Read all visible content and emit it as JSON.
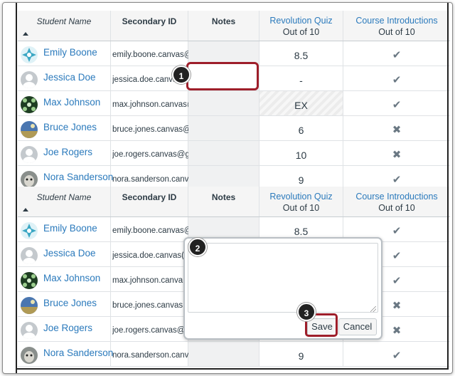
{
  "columns": {
    "student_name": "Student Name",
    "secondary_id": "Secondary ID",
    "notes": "Notes",
    "quiz": {
      "title": "Revolution Quiz",
      "sub": "Out of 10"
    },
    "intro": {
      "title": "Course Introductions",
      "sub": "Out of 10"
    }
  },
  "table1": [
    {
      "name": "Emily Boone",
      "secondary_id": "emily.boone.canvas@",
      "score": "8.5",
      "status": "✔",
      "avatar": "blue-pattern-avatar"
    },
    {
      "name": "Jessica Doe",
      "secondary_id": "jessica.doe.canvas@",
      "score": "-",
      "status": "✔",
      "avatar": "default-avatar"
    },
    {
      "name": "Max Johnson",
      "secondary_id": "max.johnson.canvas@",
      "score": "EX",
      "status": "✔",
      "avatar": "green-pattern-avatar"
    },
    {
      "name": "Bruce Jones",
      "secondary_id": "bruce.jones.canvas@",
      "score": "6",
      "status": "✖",
      "avatar": "landscape-avatar"
    },
    {
      "name": "Joe Rogers",
      "secondary_id": "joe.rogers.canvas@g",
      "score": "10",
      "status": "✖",
      "avatar": "default-avatar"
    },
    {
      "name": "Nora Sanderson",
      "secondary_id": "nora.sanderson.canv",
      "score": "9",
      "status": "✔",
      "avatar": "dog-photo-avatar"
    }
  ],
  "table2": [
    {
      "name": "Emily Boone",
      "secondary_id": "emily.boone.canvas@",
      "score": "8.5",
      "status": "✔",
      "avatar": "blue-pattern-avatar"
    },
    {
      "name": "Jessica Doe",
      "secondary_id": "jessica.doe.canvas(",
      "score": "",
      "status": "✔",
      "avatar": "default-avatar"
    },
    {
      "name": "Max Johnson",
      "secondary_id": "max.johnson.canva",
      "score": "",
      "status": "✔",
      "avatar": "green-pattern-avatar"
    },
    {
      "name": "Bruce Jones",
      "secondary_id": "bruce.jones.canvas",
      "score": "",
      "status": "✖",
      "avatar": "landscape-avatar"
    },
    {
      "name": "Joe Rogers",
      "secondary_id": "joe.rogers.canvas@",
      "score": "",
      "status": "✖",
      "avatar": "default-avatar"
    },
    {
      "name": "Nora Sanderson",
      "secondary_id": "nora.sanderson.canv",
      "score": "9",
      "status": "✔",
      "avatar": "dog-photo-avatar"
    }
  ],
  "callouts": [
    "1",
    "2",
    "3"
  ],
  "popover": {
    "save_label": "Save",
    "cancel_label": "Cancel",
    "note_value": ""
  },
  "colors": {
    "link": "#2b7abc",
    "highlight": "#9e1e2a",
    "text": "#2d3b45"
  }
}
